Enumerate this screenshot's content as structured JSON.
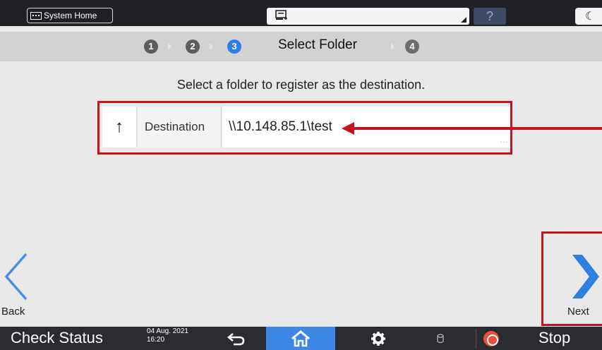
{
  "topbar": {
    "system_home_label": "System Home",
    "help_label": "?",
    "energy_icon": "moon-icon"
  },
  "stepbar": {
    "steps": [
      "1",
      "2",
      "3",
      "4"
    ],
    "current_step": 3,
    "title": "Select Folder"
  },
  "main": {
    "instruction": "Select a folder to register as the destination.",
    "destination": {
      "up_icon": "↑",
      "label": "Destination",
      "path": "\\\\10.148.85.1\\test",
      "more": "..."
    }
  },
  "nav": {
    "back_label": "Back",
    "next_label": "Next"
  },
  "bottombar": {
    "check_status_label": "Check Status",
    "date": "04 Aug. 2021",
    "time": "16:20",
    "stop_label": "Stop"
  },
  "colors": {
    "accent_blue": "#2d7fe0",
    "highlight_red": "#c5141f",
    "stop_orange": "#e8503d"
  }
}
